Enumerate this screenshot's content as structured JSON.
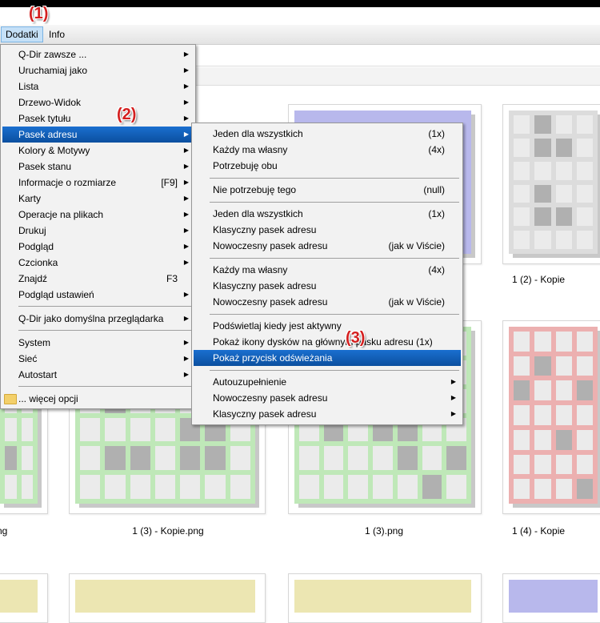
{
  "menubar": {
    "items": [
      {
        "label": "Dodatki"
      },
      {
        "label": "Info"
      }
    ]
  },
  "steps": {
    "one": "(1)",
    "two": "(2)",
    "three": "(3)"
  },
  "main_menu": {
    "items": [
      {
        "label": "Q-Dir zawsze ...",
        "shortcut": ""
      },
      {
        "label": "Uruchamiaj jako",
        "shortcut": ""
      },
      {
        "label": "Lista",
        "shortcut": ""
      },
      {
        "label": "Drzewo-Widok",
        "shortcut": ""
      },
      {
        "label": "Pasek tytułu",
        "shortcut": ""
      },
      {
        "label": "Pasek adresu",
        "shortcut": ""
      },
      {
        "label": "Kolory & Motywy",
        "shortcut": ""
      },
      {
        "label": "Pasek stanu",
        "shortcut": ""
      },
      {
        "label": "Informacje o rozmiarze",
        "shortcut": "[F9]"
      },
      {
        "label": "Karty",
        "shortcut": ""
      },
      {
        "label": "Operacje na plikach",
        "shortcut": ""
      },
      {
        "label": "Drukuj",
        "shortcut": ""
      },
      {
        "label": "Podgląd",
        "shortcut": ""
      },
      {
        "label": "Czcionka",
        "shortcut": ""
      },
      {
        "label": "Znajdź",
        "shortcut": "F3"
      },
      {
        "label": "Podgląd ustawień",
        "shortcut": ""
      },
      {
        "label": "Q-Dir jako domyślna przeglądarka",
        "shortcut": ""
      },
      {
        "label": "System",
        "shortcut": ""
      },
      {
        "label": "Sieć",
        "shortcut": ""
      },
      {
        "label": "Autostart",
        "shortcut": ""
      },
      {
        "label": "... więcej opcji",
        "shortcut": ""
      }
    ]
  },
  "sub_menu": {
    "items": [
      {
        "label": "Jeden dla wszystkich",
        "shortcut": "(1x)"
      },
      {
        "label": "Każdy ma własny",
        "shortcut": "(4x)"
      },
      {
        "label": "Potrzebuję obu",
        "shortcut": ""
      },
      {
        "label": "Nie potrzebuję tego",
        "shortcut": "(null)"
      },
      {
        "label": "Jeden dla wszystkich",
        "shortcut": "(1x)"
      },
      {
        "label": "Klasyczny pasek adresu",
        "shortcut": ""
      },
      {
        "label": "Nowoczesny pasek adresu",
        "shortcut": "(jak w Viście)"
      },
      {
        "label": "Każdy ma własny",
        "shortcut": "(4x)"
      },
      {
        "label": "Klasyczny pasek adresu",
        "shortcut": ""
      },
      {
        "label": "Nowoczesny pasek adresu",
        "shortcut": "(jak w Viście)"
      },
      {
        "label": "Podświetlaj kiedy jest aktywny",
        "shortcut": ""
      },
      {
        "label": "Pokaż ikony dysków na głównym pasku adresu (1x)",
        "shortcut": ""
      },
      {
        "label": "Pokaż przycisk odświeżania",
        "shortcut": ""
      },
      {
        "label": "Autouzupełnienie",
        "shortcut": ""
      },
      {
        "label": "Nowoczesny pasek adresu",
        "shortcut": ""
      },
      {
        "label": "Klasyczny pasek adresu",
        "shortcut": ""
      }
    ]
  },
  "captions": {
    "c1": "1 (2) - Kopie",
    "c2": "ng",
    "c3": "1 (3) - Kopie.png",
    "c4": "1 (3).png",
    "c5": "1 (4) - Kopie"
  },
  "colors": {
    "blue": "#b8b8ec",
    "gray": "#dcdcdc",
    "green": "#bfe8b8",
    "red": "#ecb0b0",
    "yellow": "#ece6b2",
    "highlight": "#0b5cb6"
  }
}
